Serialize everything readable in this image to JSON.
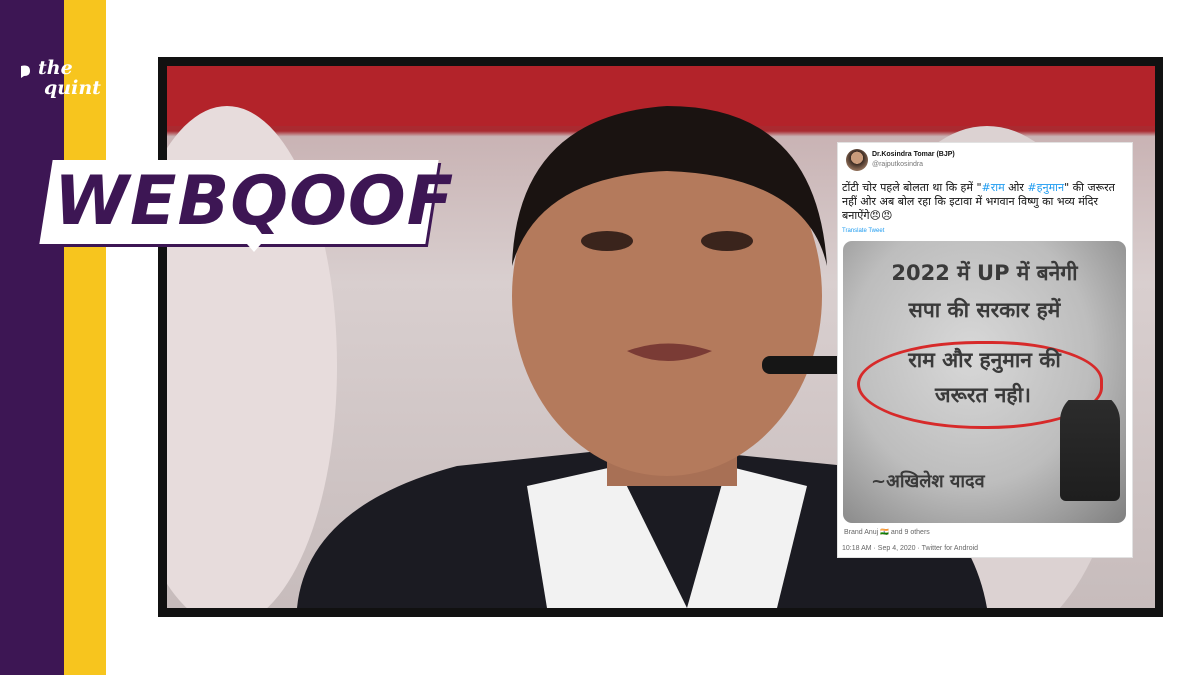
{
  "brand": {
    "line1": "the",
    "line2": "quint"
  },
  "badge": {
    "text": "WEBQOOF"
  },
  "tweet": {
    "author_name": "Dr.Kosindra Tomar (BJP)",
    "author_handle": "@rajputkosindra",
    "text_part1": "टोंटी चोर पहले बोलता था कि हमें \"",
    "hashtag1": "#राम",
    "text_part2": " ओर ",
    "hashtag2": "#हनुमान",
    "text_part3": "\" की जरूरत नहीं ओर अब बोल रहा कि इटावा में भगवान विष्णु का भव्य मंदिर बनाऐंगे😠😠",
    "translate_label": "Translate Tweet",
    "image": {
      "line1": "2022 में UP में बनेगी",
      "line2": "सपा की सरकार हमें",
      "line3": "राम और हनुमान की",
      "line4": "जरूरत नही।",
      "signature": "~अखिलेश यादव"
    },
    "liked_by": "Brand Anuj 🇮🇳 and 9 others",
    "timestamp": "10:18 AM · Sep 4, 2020 · Twitter for Android"
  }
}
